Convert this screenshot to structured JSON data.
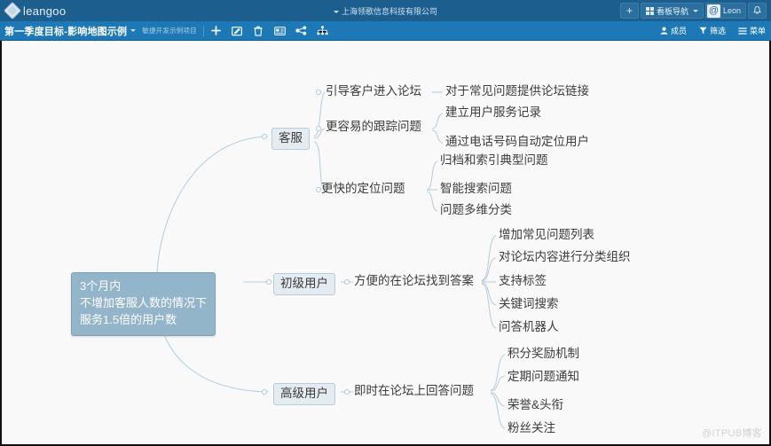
{
  "topbar": {
    "brand": "leangoo",
    "logo_icon": "diamond-logo-icon",
    "company": "上海领歌信息科技有限公司",
    "add_label": "+",
    "nav_label": "看板导航",
    "user_name": "Leon",
    "bell_icon": "bell-icon",
    "accent_color": "#1c5f8e"
  },
  "subbar": {
    "board_title": "第一季度目标-影响地图示例",
    "project_tag": "敏捷开发示例项目",
    "tools": [
      {
        "name": "add-icon",
        "label": "添加"
      },
      {
        "name": "edit-icon",
        "label": "编辑"
      },
      {
        "name": "trash-icon",
        "label": "删除"
      },
      {
        "name": "card-icon",
        "label": "卡片"
      },
      {
        "name": "share-icon",
        "label": "分享"
      },
      {
        "name": "sitemap-icon",
        "label": "结构图"
      }
    ],
    "members_label": "成员",
    "filter_label": "筛选",
    "menu_label": "菜单",
    "accent_color": "#1d79b5"
  },
  "map": {
    "root": {
      "line1": "3个月内",
      "line2": "不增加客服人数的情况下",
      "line3": "服务1.5倍的用户数",
      "fill": "#93b5c9"
    },
    "branches": [
      {
        "label": "客服",
        "children": [
          {
            "label": "引导客户进入论坛",
            "leaves": [
              "对于常见问题提供论坛链接"
            ]
          },
          {
            "label": "更容易的跟踪问题",
            "leaves": [
              "建立用户服务记录",
              "通过电话号码自动定位用户"
            ]
          },
          {
            "label": "更快的定位问题",
            "leaves": [
              "归档和索引典型问题",
              "智能搜索问题",
              "问题多维分类"
            ]
          }
        ]
      },
      {
        "label": "初级用户",
        "children": [
          {
            "label": "方便的在论坛找到答案",
            "leaves": [
              "增加常见问题列表",
              "对论坛内容进行分类组织",
              "支持标签",
              "关键词搜索",
              "问答机器人"
            ]
          }
        ]
      },
      {
        "label": "高级用户",
        "children": [
          {
            "label": "即时在论坛上回答问题",
            "leaves": [
              "积分奖励机制",
              "定期问题通知",
              "荣誉&头衔",
              "粉丝关注"
            ]
          }
        ]
      }
    ],
    "line_color": "#b9cfdd",
    "node_fill": "#e4ecf2"
  },
  "watermark": "@ITPUB博客"
}
